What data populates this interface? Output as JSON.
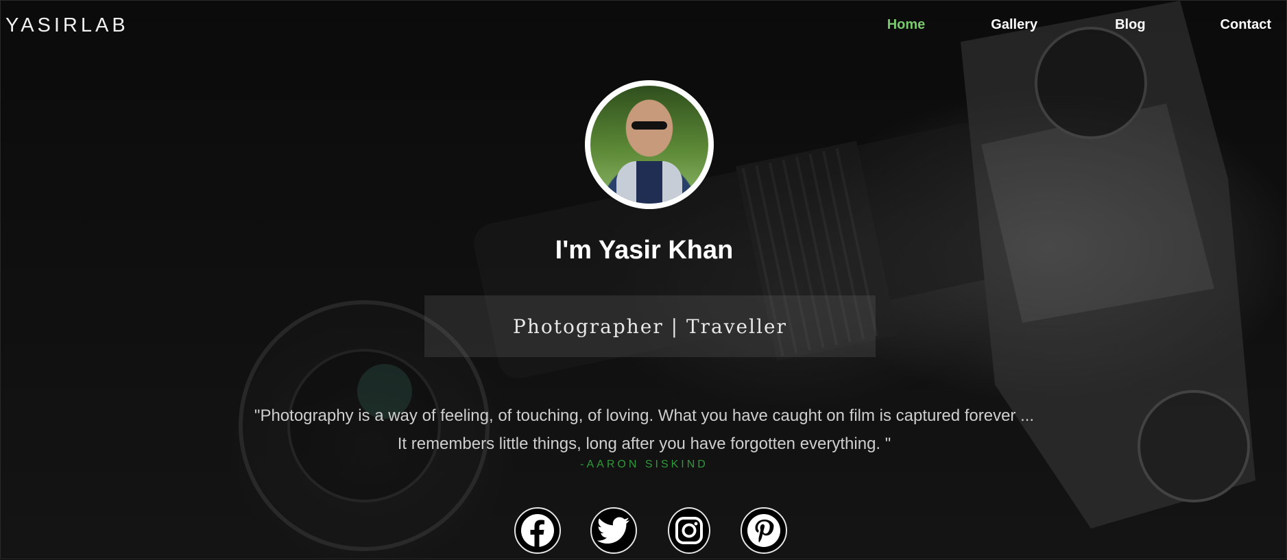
{
  "brand": "YASIRLAB",
  "nav": {
    "items": [
      {
        "label": "Home",
        "active": true
      },
      {
        "label": "Gallery",
        "active": false
      },
      {
        "label": "Blog",
        "active": false
      },
      {
        "label": "Contact",
        "active": false
      }
    ],
    "active_color": "#7bc96f"
  },
  "hero": {
    "avatar_alt": "Yasir Khan portrait",
    "headline": "I'm Yasir Khan",
    "role": "Photographer | Traveller",
    "quote_line1": "\"Photography is a way of feeling, of touching, of loving. What you have caught on film is captured forever ...",
    "quote_line2": "It remembers little things, long after you have forgotten everything. \"",
    "author": "-AARON SISKIND",
    "author_color": "#2e9a39"
  },
  "social": [
    {
      "icon": "facebook-icon"
    },
    {
      "icon": "twitter-icon"
    },
    {
      "icon": "instagram-icon"
    },
    {
      "icon": "pinterest-icon"
    }
  ]
}
